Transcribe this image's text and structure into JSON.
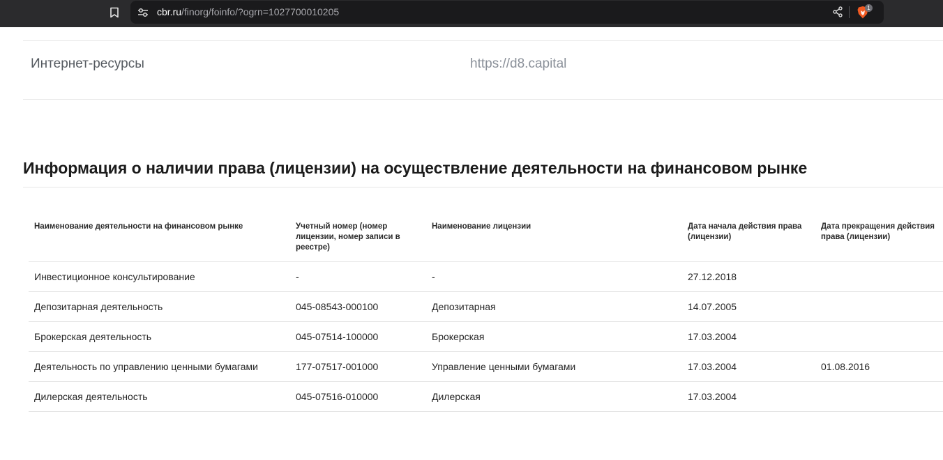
{
  "browser": {
    "url_host": "cbr.ru",
    "url_path": "/finorg/foinfo/?ogrn=1027700010205",
    "shields_count": "1"
  },
  "contacts": {
    "label": "Интернет-ресурсы",
    "value": "https://d8.capital"
  },
  "section": {
    "title": "Информация о наличии права (лицензии) на осуществление деятельности на финансовом рынке"
  },
  "table": {
    "headers": [
      "Наименование деятельности на финансовом рынке",
      "Учетный номер (номер лицензии, номер записи в реестре)",
      "Наименование лицензии",
      "Дата начала действия права (лицензии)",
      "Дата прекращения действия права (лицензии)"
    ],
    "rows": [
      [
        "Инвестиционное консультирование",
        "-",
        "-",
        "27.12.2018",
        ""
      ],
      [
        "Депозитарная деятельность",
        "045-08543-000100",
        "Депозитарная",
        "14.07.2005",
        ""
      ],
      [
        "Брокерская деятельность",
        "045-07514-100000",
        "Брокерская",
        "17.03.2004",
        ""
      ],
      [
        "Деятельность по управлению ценными бумагами",
        "177-07517-001000",
        "Управление ценными бумагами",
        "17.03.2004",
        "01.08.2016"
      ],
      [
        "Дилерская деятельность",
        "045-07516-010000",
        "Дилерская",
        "17.03.2004",
        ""
      ]
    ]
  }
}
